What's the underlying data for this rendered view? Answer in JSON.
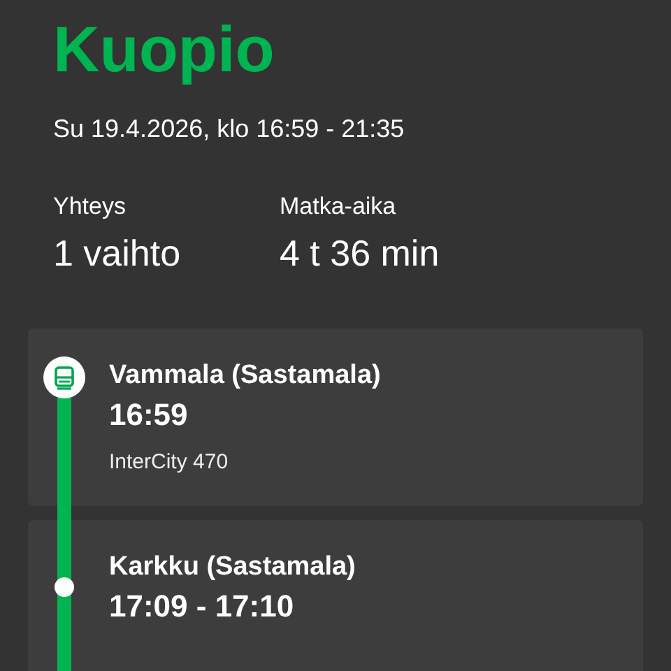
{
  "destination": "Kuopio",
  "date_time": "Su 19.4.2026, klo 16:59 - 21:35",
  "summary": [
    {
      "label": "Yhteys",
      "value": "1 vaihto"
    },
    {
      "label": "Matka-aika",
      "value": "4 t 36 min"
    }
  ],
  "stops": [
    {
      "kind": "origin",
      "name": "Vammala (Sastamala)",
      "time": "16:59",
      "service": "InterCity 470"
    },
    {
      "kind": "stop",
      "name": "Karkku (Sastamala)",
      "time": "17:09 - 17:10"
    }
  ]
}
